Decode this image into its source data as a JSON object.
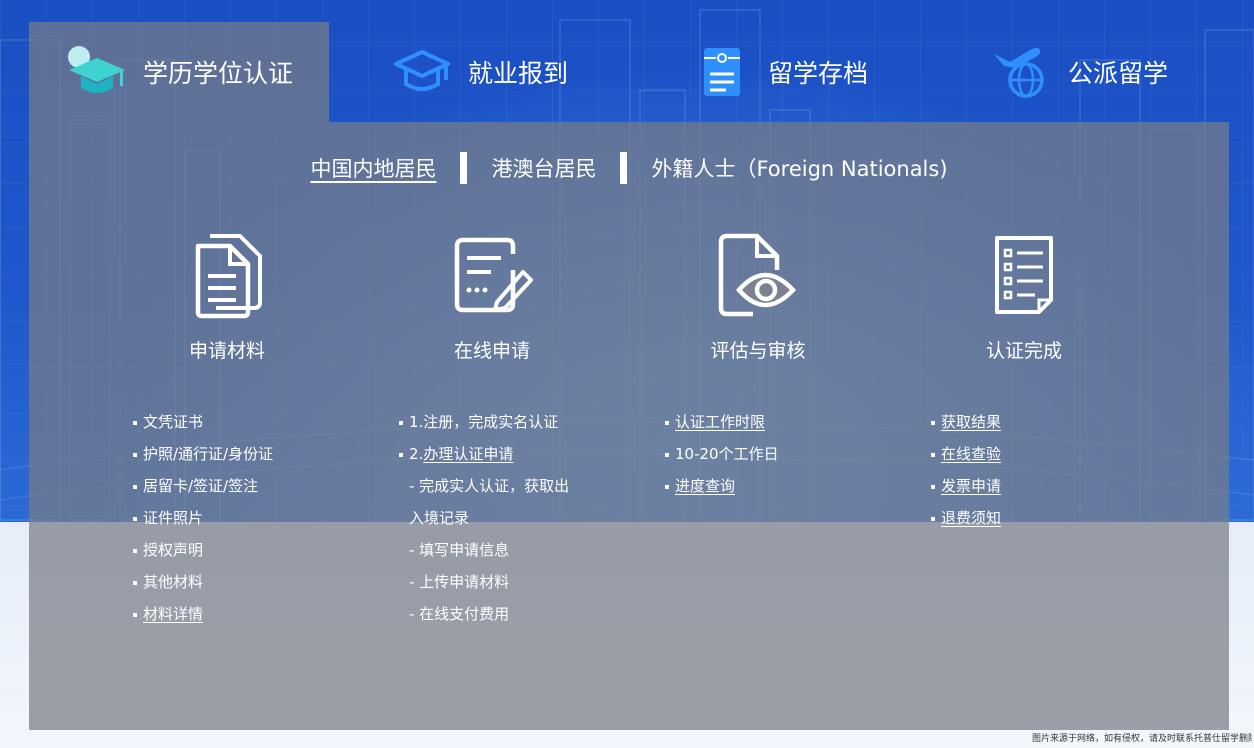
{
  "tabs": [
    {
      "label": "学历学位认证",
      "icon": "graduation-cap-icon",
      "active": true
    },
    {
      "label": "就业报到",
      "icon": "mortarboard-outline-icon",
      "active": false
    },
    {
      "label": "留学存档",
      "icon": "archive-document-icon",
      "active": false
    },
    {
      "label": "公派留学",
      "icon": "airplane-globe-icon",
      "active": false
    }
  ],
  "subnav": [
    {
      "label": "中国内地居民",
      "active": true
    },
    {
      "label": "港澳台居民",
      "active": false
    },
    {
      "label": "外籍人士（Foreign Nationals)",
      "active": false
    }
  ],
  "steps": [
    {
      "title": "申请材料",
      "icon": "documents-icon"
    },
    {
      "title": "在线申请",
      "icon": "edit-form-icon"
    },
    {
      "title": "评估与审核",
      "icon": "document-eye-icon"
    },
    {
      "title": "认证完成",
      "icon": "checklist-icon"
    }
  ],
  "lists": {
    "materials": [
      {
        "text": "文凭证书",
        "link": false
      },
      {
        "text": "护照/通行证/身份证",
        "link": false
      },
      {
        "text": "居留卡/签证/签注",
        "link": false
      },
      {
        "text": "证件照片",
        "link": false
      },
      {
        "text": "授权声明",
        "link": false
      },
      {
        "text": "其他材料",
        "link": false
      },
      {
        "text": "材料详情",
        "link": true
      }
    ],
    "online": {
      "step1": "1.注册，完成实名认证",
      "step2_prefix": "2.",
      "step2_link": "办理认证申请",
      "subs": [
        "- 完成实人认证，获取出",
        "入境记录",
        "- 填写申请信息",
        "- 上传申请材料",
        "- 在线支付费用"
      ]
    },
    "review": [
      {
        "text": "认证工作时限",
        "link": true
      },
      {
        "text": "10-20个工作日",
        "link": false
      },
      {
        "text": "进度查询",
        "link": true
      }
    ],
    "done": [
      {
        "text": "获取结果",
        "link": true
      },
      {
        "text": "在线查验",
        "link": true
      },
      {
        "text": "发票申请",
        "link": true
      },
      {
        "text": "退费须知",
        "link": true
      }
    ]
  },
  "credit": "图片来源于网络，如有侵权，请及时联系托普仕留学删除"
}
